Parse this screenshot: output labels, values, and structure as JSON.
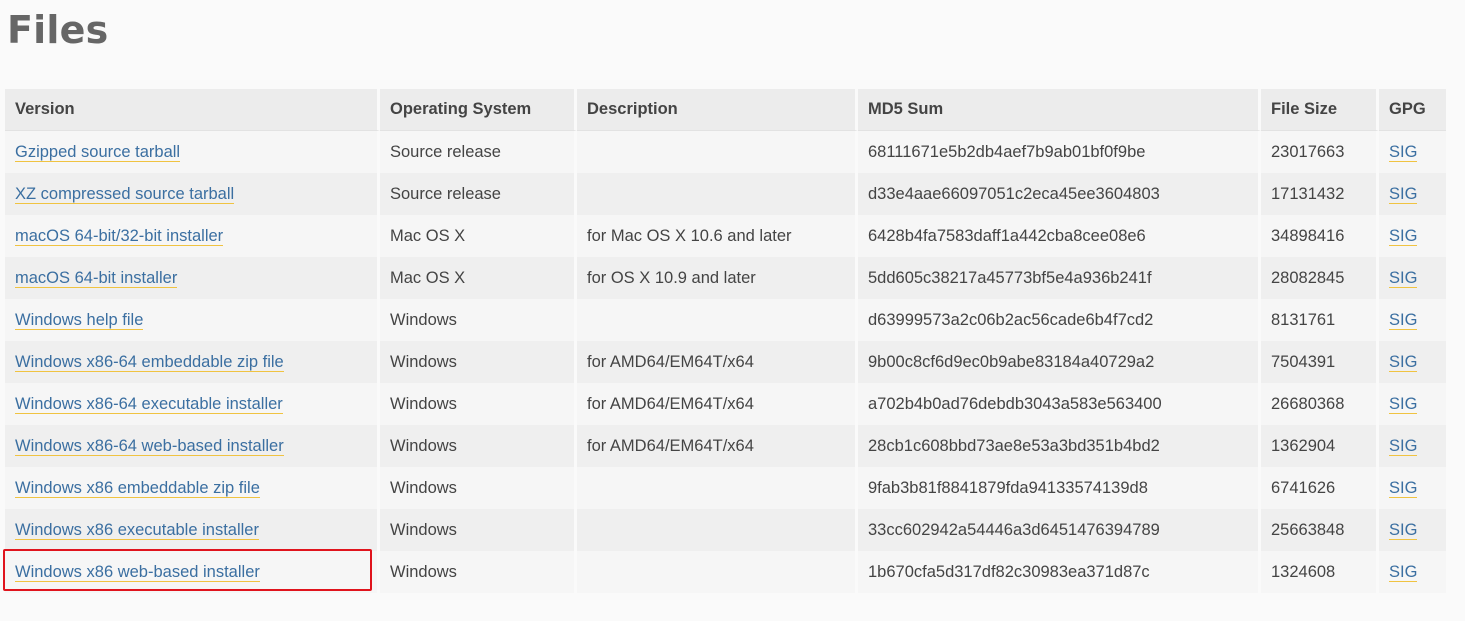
{
  "page": {
    "title": "Files"
  },
  "table": {
    "headers": [
      "Version",
      "Operating System",
      "Description",
      "MD5 Sum",
      "File Size",
      "GPG"
    ],
    "rows": [
      {
        "version": "Gzipped source tarball",
        "os": "Source release",
        "description": "",
        "md5": "68111671e5b2db4aef7b9ab01bf0f9be",
        "size": "23017663",
        "gpg": "SIG"
      },
      {
        "version": "XZ compressed source tarball",
        "os": "Source release",
        "description": "",
        "md5": "d33e4aae66097051c2eca45ee3604803",
        "size": "17131432",
        "gpg": "SIG"
      },
      {
        "version": "macOS 64-bit/32-bit installer",
        "os": "Mac OS X",
        "description": "for Mac OS X 10.6 and later",
        "md5": "6428b4fa7583daff1a442cba8cee08e6",
        "size": "34898416",
        "gpg": "SIG"
      },
      {
        "version": "macOS 64-bit installer",
        "os": "Mac OS X",
        "description": "for OS X 10.9 and later",
        "md5": "5dd605c38217a45773bf5e4a936b241f",
        "size": "28082845",
        "gpg": "SIG"
      },
      {
        "version": "Windows help file",
        "os": "Windows",
        "description": "",
        "md5": "d63999573a2c06b2ac56cade6b4f7cd2",
        "size": "8131761",
        "gpg": "SIG"
      },
      {
        "version": "Windows x86-64 embeddable zip file",
        "os": "Windows",
        "description": "for AMD64/EM64T/x64",
        "md5": "9b00c8cf6d9ec0b9abe83184a40729a2",
        "size": "7504391",
        "gpg": "SIG"
      },
      {
        "version": "Windows x86-64 executable installer",
        "os": "Windows",
        "description": "for AMD64/EM64T/x64",
        "md5": "a702b4b0ad76debdb3043a583e563400",
        "size": "26680368",
        "gpg": "SIG"
      },
      {
        "version": "Windows x86-64 web-based installer",
        "os": "Windows",
        "description": "for AMD64/EM64T/x64",
        "md5": "28cb1c608bbd73ae8e53a3bd351b4bd2",
        "size": "1362904",
        "gpg": "SIG"
      },
      {
        "version": "Windows x86 embeddable zip file",
        "os": "Windows",
        "description": "",
        "md5": "9fab3b81f8841879fda94133574139d8",
        "size": "6741626",
        "gpg": "SIG"
      },
      {
        "version": "Windows x86 executable installer",
        "os": "Windows",
        "description": "",
        "md5": "33cc602942a54446a3d6451476394789",
        "size": "25663848",
        "gpg": "SIG"
      },
      {
        "version": "Windows x86 web-based installer",
        "os": "Windows",
        "description": "",
        "md5": "1b670cfa5d317df82c30983ea371d87c",
        "size": "1324608",
        "gpg": "SIG"
      }
    ]
  },
  "colors": {
    "link": "#3b6fa1",
    "link_underline": "#f0c341",
    "highlight": "#e0141d"
  }
}
